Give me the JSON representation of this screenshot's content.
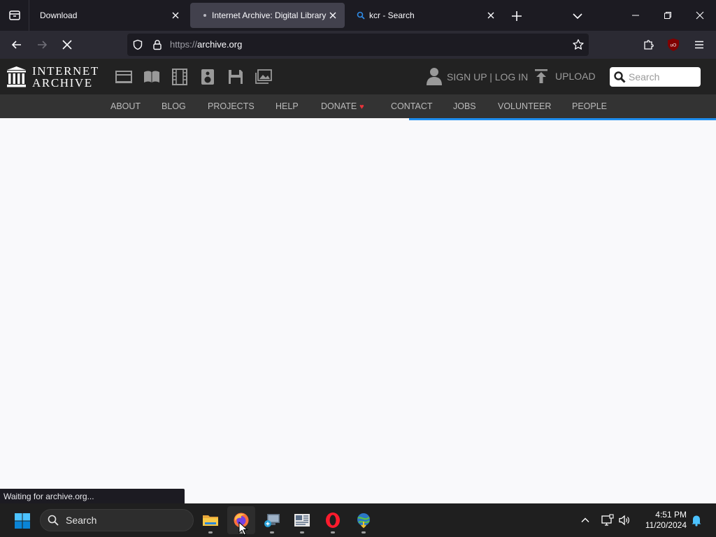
{
  "browser": {
    "tabs": [
      {
        "title": "Download"
      },
      {
        "title": "Internet Archive: Digital Library of Free & Borrowable Books"
      },
      {
        "title": "kcr - Search"
      }
    ],
    "url": {
      "scheme": "https://",
      "host": "archive.org"
    },
    "status_text": "Waiting for archive.org..."
  },
  "site": {
    "logo": {
      "line1": "INTERNET",
      "line2": "ARCHIVE"
    },
    "signup_label": "SIGN UP | LOG IN",
    "upload_label": "UPLOAD",
    "search_placeholder": "Search",
    "nav": [
      "ABOUT",
      "BLOG",
      "PROJECTS",
      "HELP",
      "DONATE",
      "CONTACT",
      "JOBS",
      "VOLUNTEER",
      "PEOPLE"
    ]
  },
  "taskbar": {
    "search_label": "Search",
    "time": "4:51 PM",
    "date": "11/20/2024"
  },
  "colors": {
    "accent_loading": "#1e8ef0",
    "donate_heart": "#e8333a"
  }
}
